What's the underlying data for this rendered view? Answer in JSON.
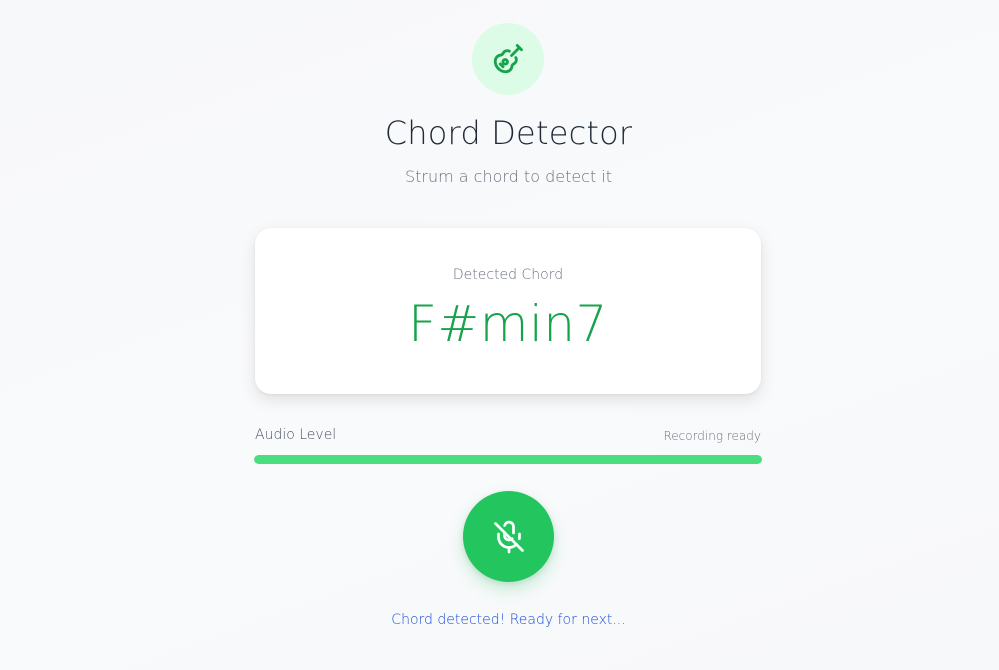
{
  "header": {
    "logo_icon": "guitar-icon",
    "title": "Chord Detector",
    "subtitle": "Strum a chord to detect it"
  },
  "detection": {
    "label": "Detected Chord",
    "chord": "F#min7"
  },
  "audio": {
    "label": "Audio Level",
    "status": "Recording ready",
    "level_percent": 100
  },
  "controls": {
    "mic_icon": "microphone-off-icon"
  },
  "footer": {
    "status": "Chord detected! Ready for next..."
  },
  "colors": {
    "accent": "#22c55e",
    "chord_text": "#16a34a",
    "logo_bg": "#dcfce7",
    "status_text": "#1d4ed8",
    "level_fill": "#4ade80"
  }
}
